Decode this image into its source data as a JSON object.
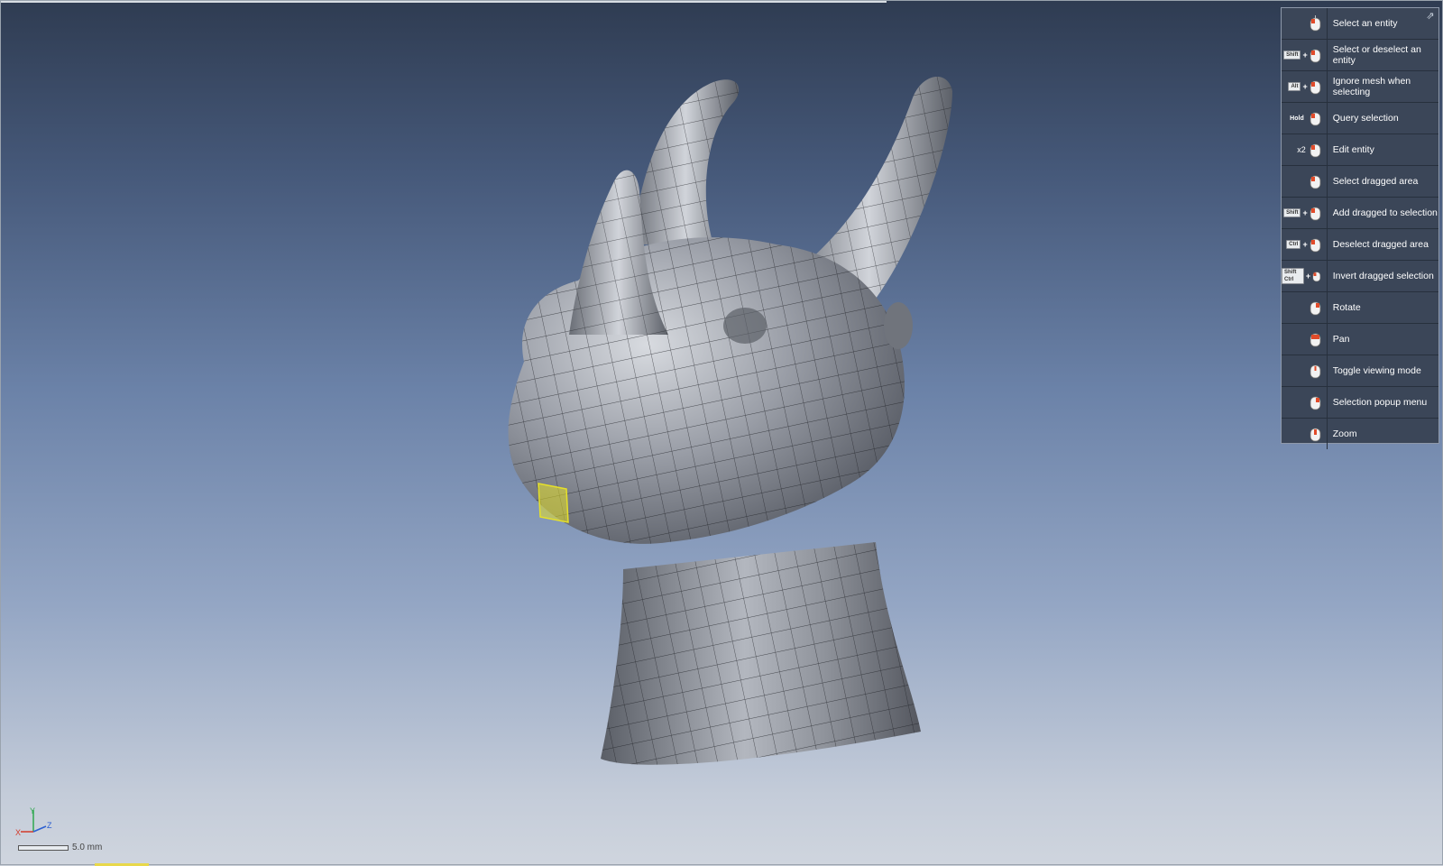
{
  "help_panel": {
    "items": [
      {
        "label": "Select an entity",
        "modifier": ""
      },
      {
        "label": "Select or deselect an entity",
        "modifier": "Shift"
      },
      {
        "label": "Ignore mesh when selecting",
        "modifier": "Alt"
      },
      {
        "label": "Query selection",
        "modifier": "Hold"
      },
      {
        "label": "Edit entity",
        "modifier": "x2"
      },
      {
        "label": "Select dragged area",
        "modifier": ""
      },
      {
        "label": "Add dragged to selection",
        "modifier": "Shift"
      },
      {
        "label": "Deselect dragged area",
        "modifier": "Ctrl"
      },
      {
        "label": "Invert dragged selection",
        "modifier": "Shift Ctrl"
      },
      {
        "label": "Rotate",
        "modifier": ""
      },
      {
        "label": "Pan",
        "modifier": ""
      },
      {
        "label": "Toggle viewing mode",
        "modifier": ""
      },
      {
        "label": "Selection popup menu",
        "modifier": ""
      },
      {
        "label": "Zoom",
        "modifier": ""
      }
    ]
  },
  "triad": {
    "x": "X",
    "y": "Y",
    "z": "Z"
  },
  "scale": {
    "label": "5.0 mm"
  },
  "colors": {
    "selection": "#e5e02a",
    "panel_bg": "#3b4658",
    "mouse_accent": "#e14b2a"
  }
}
